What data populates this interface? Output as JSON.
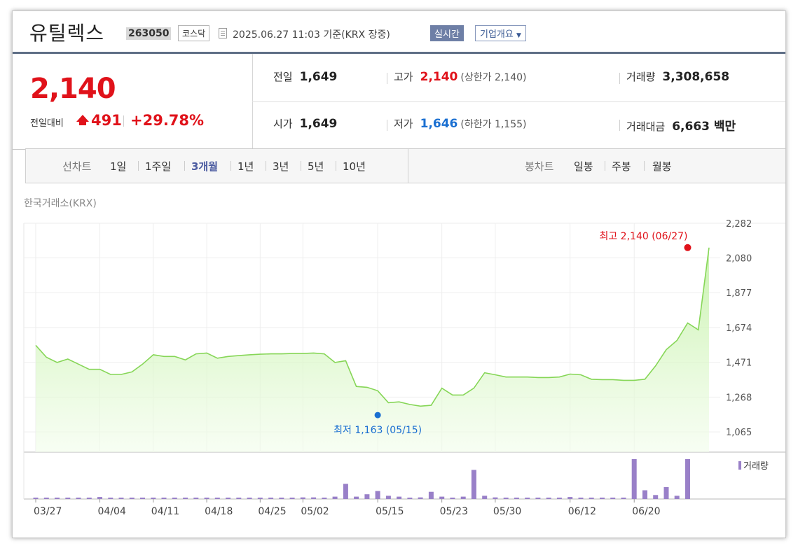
{
  "header": {
    "title": "유틸렉스",
    "code": "263050",
    "market": "코스닥",
    "as_of": "2025.06.27 11:03  기준(KRX 장중)",
    "realtime_label": "실시간",
    "overview_label": "기업개요"
  },
  "summary": {
    "price": "2,140",
    "prev_label": "전일대비",
    "change": "491",
    "change_pct": "+29.78%",
    "prev_close_label": "전일",
    "prev_close": "1,649",
    "open_label": "시가",
    "open": "1,649",
    "high_label": "고가",
    "high": "2,140",
    "upper_limit": "(상한가 2,140)",
    "low_label": "저가",
    "low": "1,646",
    "lower_limit": "(하한가 1,155)",
    "volume_label": "거래량",
    "volume": "3,308,658",
    "amount_label": "거래대금",
    "amount": "6,663 백만"
  },
  "period_tabs": {
    "label": "선차트",
    "items": [
      "1일",
      "1주일",
      "3개월",
      "1년",
      "3년",
      "5년",
      "10년"
    ],
    "active": "3개월"
  },
  "candle_tabs": {
    "label": "봉차트",
    "items": [
      "일봉",
      "주봉",
      "월봉"
    ]
  },
  "colors": {
    "up": "#e0121a",
    "down": "#1a6fd1",
    "line": "#7fd34e",
    "volume": "#9980c8"
  },
  "chart_data": {
    "type": "area",
    "exchange_label": "한국거래소(KRX)",
    "price_series": {
      "x": [
        "03/27",
        "03/28",
        "03/31",
        "04/01",
        "04/02",
        "04/03",
        "04/04",
        "04/07",
        "04/08",
        "04/09",
        "04/10",
        "04/11",
        "04/14",
        "04/15",
        "04/16",
        "04/17",
        "04/18",
        "04/21",
        "04/22",
        "04/23",
        "04/24",
        "04/25",
        "04/28",
        "04/29",
        "04/30",
        "05/02",
        "05/07",
        "05/08",
        "05/09",
        "05/12",
        "05/13",
        "05/14",
        "05/15",
        "05/16",
        "05/19",
        "05/20",
        "05/21",
        "05/22",
        "05/23",
        "05/26",
        "05/27",
        "05/28",
        "05/29",
        "05/30",
        "06/02",
        "06/04",
        "06/05",
        "06/09",
        "06/10",
        "06/11",
        "06/12",
        "06/13",
        "06/16",
        "06/17",
        "06/18",
        "06/19",
        "06/20",
        "06/23",
        "06/24",
        "06/25",
        "06/26",
        "06/27"
      ],
      "y": [
        1570,
        1500,
        1470,
        1490,
        1460,
        1430,
        1430,
        1400,
        1400,
        1415,
        1460,
        1515,
        1505,
        1505,
        1485,
        1520,
        1525,
        1495,
        1505,
        1510,
        1515,
        1518,
        1520,
        1520,
        1522,
        1522,
        1525,
        1520,
        1470,
        1480,
        1330,
        1325,
        1305,
        1235,
        1240,
        1225,
        1215,
        1220,
        1320,
        1280,
        1280,
        1320,
        1410,
        1398,
        1385,
        1385,
        1385,
        1382,
        1382,
        1385,
        1402,
        1398,
        1372,
        1370,
        1370,
        1366,
        1366,
        1372,
        1450,
        1545,
        1598,
        1700,
        1660,
        2140
      ],
      "yticks": [
        1065,
        1268,
        1471,
        1674,
        1877,
        2080,
        2282
      ],
      "ylim": [
        1000,
        2282
      ],
      "xticks": [
        "03/27",
        "04/04",
        "04/11",
        "04/18",
        "04/25",
        "05/02",
        "05/15",
        "05/23",
        "05/30",
        "06/12",
        "06/20"
      ],
      "high": {
        "label": "최고 2,140 (06/27)",
        "value": 2140,
        "date": "06/27"
      },
      "low": {
        "label": "최저 1,163 (05/15)",
        "value": 1163,
        "date": "05/15"
      }
    },
    "volume_series": {
      "name": "거래량",
      "relative_values": [
        0.03,
        0.03,
        0.03,
        0.02,
        0.02,
        0.03,
        0.05,
        0.03,
        0.02,
        0.03,
        0.03,
        0.03,
        0.03,
        0.02,
        0.03,
        0.02,
        0.03,
        0.02,
        0.02,
        0.02,
        0.03,
        0.03,
        0.02,
        0.02,
        0.03,
        0.04,
        0.04,
        0.03,
        0.06,
        0.38,
        0.06,
        0.12,
        0.2,
        0.08,
        0.06,
        0.03,
        0.04,
        0.18,
        0.06,
        0.03,
        0.06,
        0.73,
        0.08,
        0.04,
        0.03,
        0.03,
        0.03,
        0.03,
        0.03,
        0.03,
        0.05,
        0.03,
        0.03,
        0.03,
        0.02,
        0.03,
        1.0,
        0.22,
        0.1,
        0.3,
        0.08,
        1.0
      ]
    }
  }
}
